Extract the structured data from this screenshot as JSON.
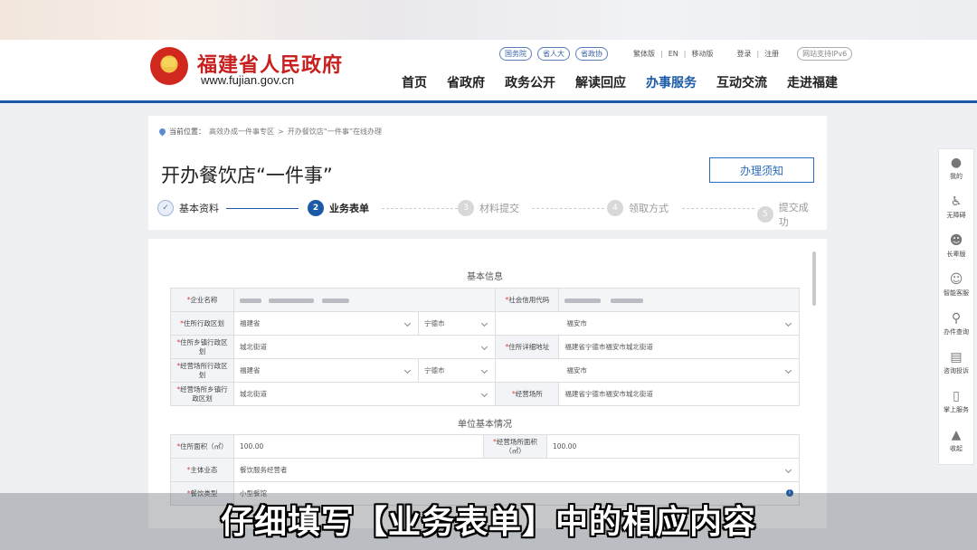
{
  "header": {
    "site_name": "福建省人民政府",
    "site_url": "www.fujian.gov.cn",
    "top_links": {
      "pill1": "国务院",
      "pill2": "省人大",
      "pill3": "省政协",
      "lang_trad": "繁体版",
      "lang_en": "EN",
      "mobile": "移动版",
      "login": "登录",
      "register": "注册",
      "ipv6": "网站支持IPv6"
    },
    "nav": [
      "首页",
      "省政府",
      "政务公开",
      "解读回应",
      "办事服务",
      "互动交流",
      "走进福建"
    ],
    "nav_active_index": 4
  },
  "breadcrumb": {
    "label": "当前位置：",
    "items": [
      "高效办成一件事专区",
      "开办餐饮店“一件事”在线办理"
    ],
    "separator": ">"
  },
  "page": {
    "title": "开办餐饮店“一件事”",
    "notice_button": "办理须知"
  },
  "steps": [
    {
      "num": "✓",
      "label": "基本资料",
      "state": "done"
    },
    {
      "num": "2",
      "label": "业务表单",
      "state": "current"
    },
    {
      "num": "3",
      "label": "材料提交",
      "state": "pending"
    },
    {
      "num": "4",
      "label": "领取方式",
      "state": "pending"
    },
    {
      "num": "5",
      "label": "提交成功",
      "state": "pending"
    }
  ],
  "form": {
    "section1_title": "基本信息",
    "section2_title": "单位基本情况",
    "labels": {
      "company_name": "企业名称",
      "credit_code": "社会信用代码",
      "res_region": "住所行政区划",
      "res_town": "住所乡镇行政区划",
      "res_address": "住所详细地址",
      "biz_region": "经营场所行政区划",
      "biz_town": "经营场所乡镇行政区划",
      "biz_place": "经营场所",
      "res_area": "住所面积（㎡）",
      "biz_area": "经营场所面积（㎡）",
      "main_format": "主体业态",
      "food_type": "餐饮类型"
    },
    "values": {
      "res_province": "福建省",
      "res_city": "宁德市",
      "res_county": "福安市",
      "res_town": "城北街道",
      "res_address": "福建省宁德市福安市城北街道",
      "biz_province": "福建省",
      "biz_city": "宁德市",
      "biz_county": "福安市",
      "biz_town": "城北街道",
      "biz_place": "福建省宁德市福安市城北街道",
      "res_area": "100.00",
      "biz_area": "100.00",
      "main_format": "餐饮服务经营者",
      "food_type": "小型餐馆"
    }
  },
  "sidebar": [
    {
      "label": "我的",
      "icon": "user-icon"
    },
    {
      "label": "无障碍",
      "icon": "accessibility-icon"
    },
    {
      "label": "长辈版",
      "icon": "elder-icon"
    },
    {
      "label": "智能客服",
      "icon": "robot-icon"
    },
    {
      "label": "办件查询",
      "icon": "search-icon"
    },
    {
      "label": "咨询投诉",
      "icon": "chat-icon"
    },
    {
      "label": "掌上服务",
      "icon": "mobile-icon"
    },
    {
      "label": "收起",
      "icon": "collapse-icon"
    }
  ],
  "caption": "仔细填写【业务表单】中的相应内容",
  "colors": {
    "brand_blue": "#1b5aa6",
    "brand_red": "#c81f1f"
  }
}
